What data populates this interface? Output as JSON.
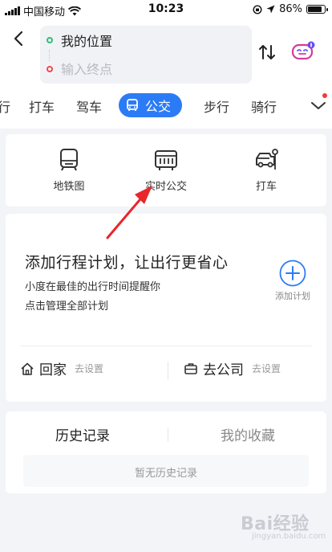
{
  "status_bar": {
    "carrier": "中国移动",
    "time": "10:23",
    "battery": "86%",
    "battery_level": 0.86
  },
  "header": {
    "start_point": "我的位置",
    "end_placeholder": "输入终点"
  },
  "mode_tabs": [
    {
      "label": "行"
    },
    {
      "label": "打车"
    },
    {
      "label": "驾车"
    },
    {
      "label": "公交",
      "active": true
    },
    {
      "label": "步行"
    },
    {
      "label": "骑行"
    }
  ],
  "quick_entries": [
    {
      "label": "地铁图",
      "icon": "subway-icon"
    },
    {
      "label": "实时公交",
      "icon": "realtime-bus-icon"
    },
    {
      "label": "打车",
      "icon": "taxi-icon"
    }
  ],
  "plan_card": {
    "title": "添加行程计划，让出行更省心",
    "desc_line1": "小度在最佳的出行时间提醒你",
    "desc_line2": "点击管理全部计划",
    "add_label": "添加计划",
    "home_label": "回家",
    "home_action": "去设置",
    "company_label": "去公司",
    "company_action": "去设置"
  },
  "history_card": {
    "tab_history": "历史记录",
    "tab_favorites": "我的收藏",
    "empty_text": "暂无历史记录"
  },
  "watermark": {
    "logo": "Bai经验",
    "sub": "jingyan.baidu.com"
  },
  "colors": {
    "accent": "#2c7bf6",
    "start_dot": "#2fbf71",
    "end_dot": "#ef4b4b",
    "annotation": "#e8262b"
  }
}
